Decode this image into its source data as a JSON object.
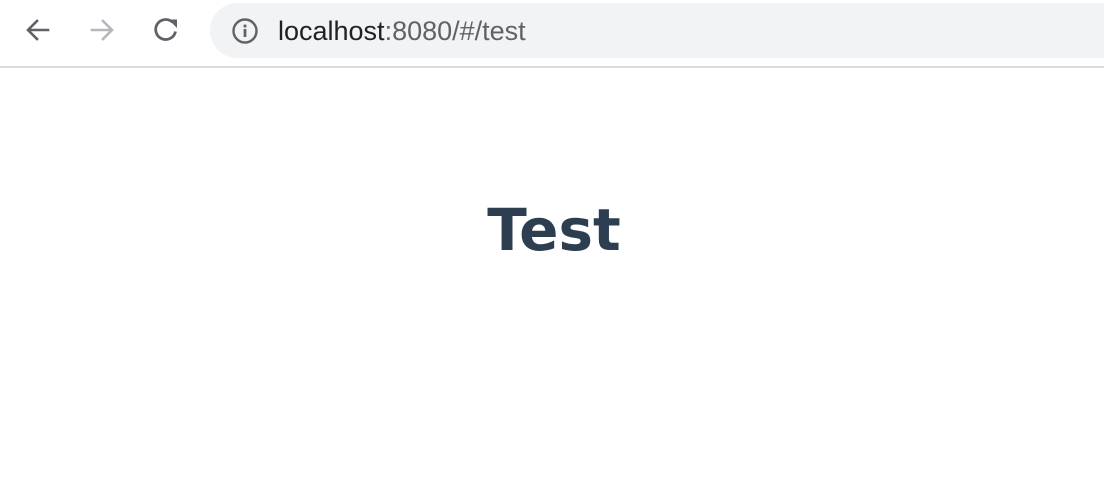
{
  "browser": {
    "back_icon": "arrow-left-icon",
    "forward_icon": "arrow-right-icon",
    "reload_icon": "reload-icon",
    "site_info_icon": "info-circle-icon",
    "url_host": "localhost",
    "url_rest": ":8080/#/test"
  },
  "page": {
    "heading": "Test"
  },
  "colors": {
    "heading": "#2c3e50",
    "omnibox_bg": "#f1f3f4",
    "icon": "#5f6368",
    "icon_disabled": "#b5b8bb"
  }
}
